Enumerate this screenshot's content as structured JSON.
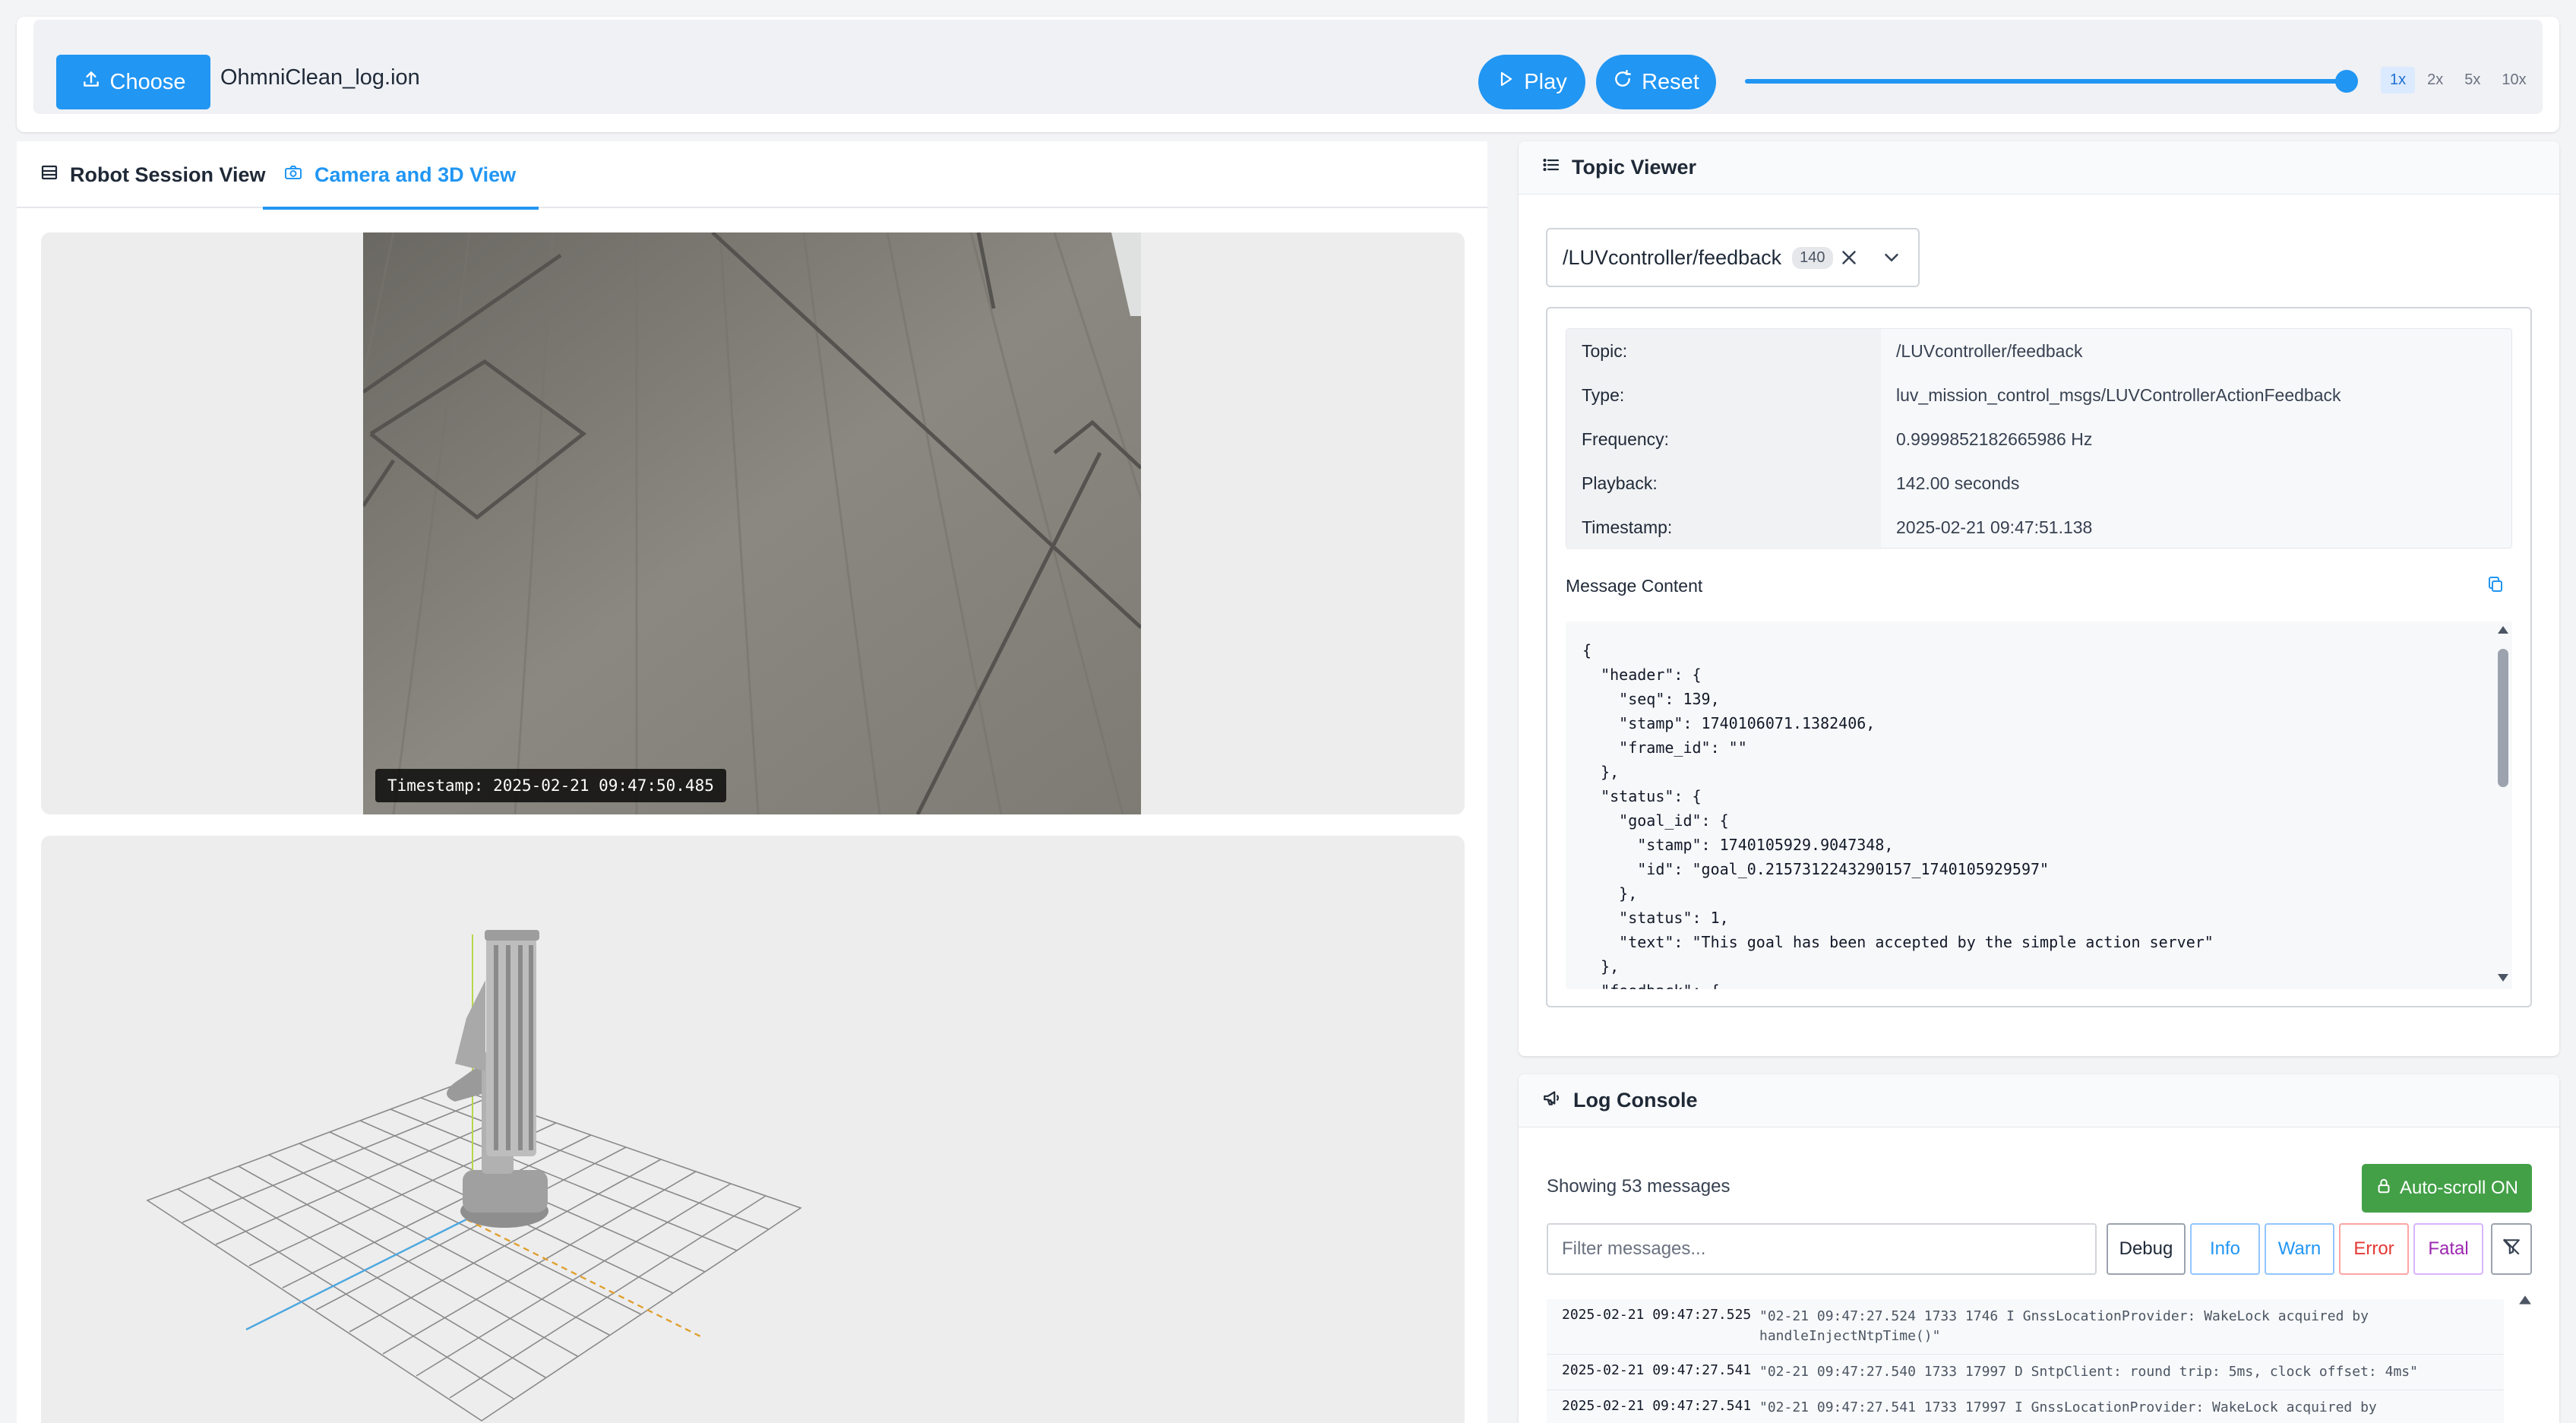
{
  "toolbar": {
    "choose_label": "Choose",
    "file_name": "OhmniClean_log.ion",
    "play_label": "Play",
    "reset_label": "Reset",
    "progress": 0.99,
    "speeds": [
      "1x",
      "2x",
      "5x",
      "10x"
    ],
    "active_speed": "1x",
    "accent_color": "#2196f3"
  },
  "tabs": {
    "robot_session": "Robot Session View",
    "camera_3d": "Camera and 3D View"
  },
  "camera": {
    "timestamp": "Timestamp: 2025-02-21 09:47:50.485"
  },
  "topic_viewer": {
    "title": "Topic Viewer",
    "selected_topic": "/LUVcontroller/feedback",
    "message_count": "140",
    "info": [
      {
        "key": "Topic:",
        "value": "/LUVcontroller/feedback"
      },
      {
        "key": "Type:",
        "value": "luv_mission_control_msgs/LUVControllerActionFeedback"
      },
      {
        "key": "Frequency:",
        "value": "0.9999852182665986 Hz"
      },
      {
        "key": "Playback:",
        "value": "142.00 seconds"
      },
      {
        "key": "Timestamp:",
        "value": "2025-02-21 09:47:51.138"
      }
    ],
    "message_content_label": "Message Content",
    "message_json": "{\n  \"header\": {\n    \"seq\": 139,\n    \"stamp\": 1740106071.1382406,\n    \"frame_id\": \"\"\n  },\n  \"status\": {\n    \"goal_id\": {\n      \"stamp\": 1740105929.9047348,\n      \"id\": \"goal_0.2157312243290157_1740105929597\"\n    },\n    \"status\": 1,\n    \"text\": \"This goal has been accepted by the simple action server\"\n  },\n  \"feedback\": {"
  },
  "log_console": {
    "title": "Log Console",
    "count_text": "Showing 53 messages",
    "autoscroll_label": "Auto-scroll ON",
    "filter_placeholder": "Filter messages...",
    "levels": {
      "debug": "Debug",
      "info": "Info",
      "warn": "Warn",
      "error": "Error",
      "fatal": "Fatal"
    },
    "entries": [
      {
        "time": "2025-02-21 09:47:27.525",
        "message": "\"02-21 09:47:27.524 1733 1746 I GnssLocationProvider: WakeLock acquired by handleInjectNtpTime()\""
      },
      {
        "time": "2025-02-21 09:47:27.541",
        "message": "\"02-21 09:47:27.540 1733 17997 D SntpClient: round trip: 5ms, clock offset: 4ms\""
      },
      {
        "time": "2025-02-21 09:47:27.541",
        "message": "\"02-21 09:47:27.541 1733 17997 I GnssLocationProvider: WakeLock acquired by"
      }
    ]
  }
}
